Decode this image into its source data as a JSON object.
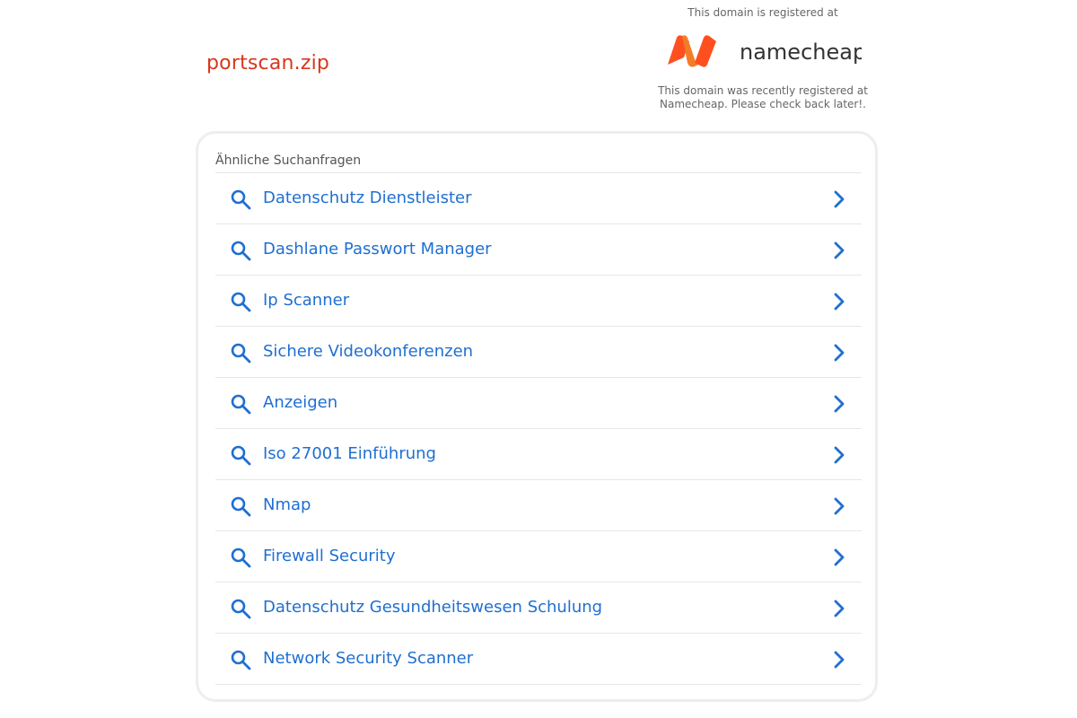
{
  "domain": "portscan.zip",
  "registrar": {
    "top_text": "This domain is registered at",
    "logo_name": "namecheap",
    "bottom_text_line1": "This domain was recently registered at",
    "bottom_text_line2": "Namecheap. Please check back later!.",
    "logo_colors": [
      "#ff4f1f",
      "#f57c27"
    ]
  },
  "related": {
    "heading": "Ähnliche Suchanfragen",
    "items": [
      {
        "label": "Datenschutz Dienstleister"
      },
      {
        "label": "Dashlane Passwort Manager"
      },
      {
        "label": "Ip Scanner"
      },
      {
        "label": "Sichere Videokonferenzen"
      },
      {
        "label": "Anzeigen"
      },
      {
        "label": "Iso 27001 Einführung"
      },
      {
        "label": "Nmap"
      },
      {
        "label": "Firewall Security"
      },
      {
        "label": "Datenschutz Gesundheitswesen Schulung"
      },
      {
        "label": "Network Security Scanner"
      }
    ]
  },
  "colors": {
    "domain_title": "#d9361c",
    "link": "#1f6fd1",
    "icon": "#1f6fd1"
  },
  "icons": {
    "item_icon": "search-icon",
    "item_arrow": "chevron-right-icon"
  }
}
